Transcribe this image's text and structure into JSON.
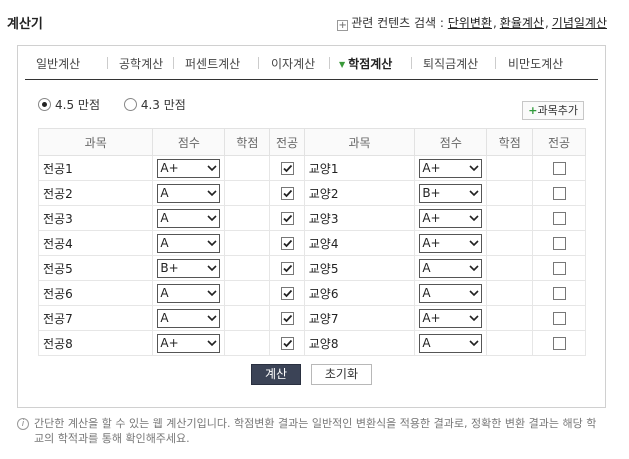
{
  "header": {
    "title": "계산기",
    "related_label": "관련 컨텐츠 검색 :",
    "related_links": [
      "단위변환",
      "환율계산",
      "기념일계산"
    ]
  },
  "tabs": [
    {
      "label": "일반계산",
      "active": false
    },
    {
      "label": "공학계산",
      "active": false
    },
    {
      "label": "퍼센트계산",
      "active": false
    },
    {
      "label": "이자계산",
      "active": false
    },
    {
      "label": "학점계산",
      "active": true
    },
    {
      "label": "퇴직금계산",
      "active": false
    },
    {
      "label": "비만도계산",
      "active": false
    }
  ],
  "scale_options": [
    {
      "label": "4.5 만점",
      "checked": true
    },
    {
      "label": "4.3 만점",
      "checked": false
    }
  ],
  "add_subject_label": "과목추가",
  "table": {
    "headers": [
      "과목",
      "점수",
      "학점",
      "전공",
      "과목",
      "점수",
      "학점",
      "전공"
    ],
    "rows": [
      {
        "left": {
          "name": "전공1",
          "grade": "A+",
          "credit": "",
          "major": true
        },
        "right": {
          "name": "교양1",
          "grade": "A+",
          "credit": "",
          "major": false
        }
      },
      {
        "left": {
          "name": "전공2",
          "grade": "A",
          "credit": "",
          "major": true
        },
        "right": {
          "name": "교양2",
          "grade": "B+",
          "credit": "",
          "major": false
        }
      },
      {
        "left": {
          "name": "전공3",
          "grade": "A",
          "credit": "",
          "major": true
        },
        "right": {
          "name": "교양3",
          "grade": "A+",
          "credit": "",
          "major": false
        }
      },
      {
        "left": {
          "name": "전공4",
          "grade": "A",
          "credit": "",
          "major": true
        },
        "right": {
          "name": "교양4",
          "grade": "A+",
          "credit": "",
          "major": false
        }
      },
      {
        "left": {
          "name": "전공5",
          "grade": "B+",
          "credit": "",
          "major": true
        },
        "right": {
          "name": "교양5",
          "grade": "A",
          "credit": "",
          "major": false
        }
      },
      {
        "left": {
          "name": "전공6",
          "grade": "A",
          "credit": "",
          "major": true
        },
        "right": {
          "name": "교양6",
          "grade": "A",
          "credit": "",
          "major": false
        }
      },
      {
        "left": {
          "name": "전공7",
          "grade": "A",
          "credit": "",
          "major": true
        },
        "right": {
          "name": "교양7",
          "grade": "A+",
          "credit": "",
          "major": false
        }
      },
      {
        "left": {
          "name": "전공8",
          "grade": "A+",
          "credit": "",
          "major": true
        },
        "right": {
          "name": "교양8",
          "grade": "A",
          "credit": "",
          "major": false
        }
      }
    ]
  },
  "buttons": {
    "calculate": "계산",
    "reset": "초기화"
  },
  "notice": "간단한 계산을 할 수 있는 웹 계산기입니다. 학점변환 결과는 일반적인 변환식을 적용한 결과로, 정확한 변환 결과는 해당 학교의 학적과를 통해 확인해주세요."
}
